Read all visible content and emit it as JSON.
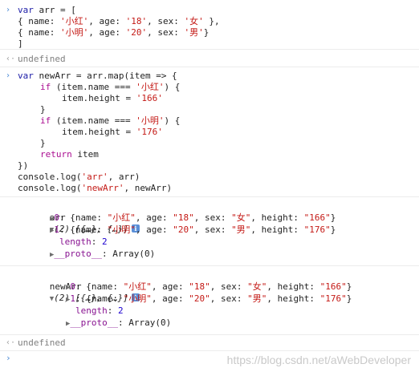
{
  "prompt_glyph": "›",
  "return_glyph": "‹·",
  "expand_glyph": "▶",
  "collapse_glyph": "▼",
  "info_glyph": "i",
  "entry1": {
    "l1_kw": "var",
    "l1_rest": " arr = [",
    "l2_a": "{ name: ",
    "l2_name": "'小红'",
    "l2_b": ", age: ",
    "l2_age": "'18'",
    "l2_c": ", sex: ",
    "l2_sex": "'女'",
    "l2_d": " },",
    "l3_a": "{ name: ",
    "l3_name": "'小明'",
    "l3_b": ", age: ",
    "l3_age": "'20'",
    "l3_c": ", sex: ",
    "l3_sex": "'男'",
    "l3_d": "}",
    "l4": "]"
  },
  "result1": "undefined",
  "entry2": {
    "l1_kw": "var",
    "l1_rest": " newArr = arr.map(item => {",
    "l2_kw": "if",
    "l2_a": " (item.name === ",
    "l2_str": "'小红'",
    "l2_b": ") {",
    "l3_a": "item.height = ",
    "l3_str": "'166'",
    "l4": "}",
    "l5_kw": "if",
    "l5_a": " (item.name === ",
    "l5_str": "'小明'",
    "l5_b": ") {",
    "l6_a": "item.height = ",
    "l6_str": "'176'",
    "l7": "}",
    "l8_kw": "return",
    "l8_rest": " item",
    "l9": "})",
    "l10_a": "console.log(",
    "l10_str": "'arr'",
    "l10_b": ", arr)",
    "l11_a": "console.log(",
    "l11_str": "'newArr'",
    "l11_b": ", newArr)"
  },
  "log_arr": {
    "label": "arr",
    "summary": "(2) [{…}, {…}]",
    "item0_key": "0",
    "item0_a": ": {name: ",
    "item0_name": "\"小红\"",
    "item0_b": ", age: ",
    "item0_age": "\"18\"",
    "item0_c": ", sex: ",
    "item0_sex": "\"女\"",
    "item0_d": ", height: ",
    "item0_height": "\"166\"",
    "item0_e": "}",
    "item1_key": "1",
    "item1_a": ": {name: ",
    "item1_name": "\"小明\"",
    "item1_b": ", age: ",
    "item1_age": "\"20\"",
    "item1_c": ", sex: ",
    "item1_sex": "\"男\"",
    "item1_d": ", height: ",
    "item1_height": "\"176\"",
    "item1_e": "}",
    "length_key": "length",
    "length_val": "2",
    "proto_key": "__proto__",
    "proto_val": "Array(0)"
  },
  "log_newarr": {
    "label": "newArr",
    "summary": "(2) [{…}, {…}]",
    "item0_key": "0",
    "item0_a": ": {name: ",
    "item0_name": "\"小红\"",
    "item0_b": ", age: ",
    "item0_age": "\"18\"",
    "item0_c": ", sex: ",
    "item0_sex": "\"女\"",
    "item0_d": ", height: ",
    "item0_height": "\"166\"",
    "item0_e": "}",
    "item1_key": "1",
    "item1_a": ": {name: ",
    "item1_name": "\"小明\"",
    "item1_b": ", age: ",
    "item1_age": "\"20\"",
    "item1_c": ", sex: ",
    "item1_sex": "\"男\"",
    "item1_d": ", height: ",
    "item1_height": "\"176\"",
    "item1_e": "}",
    "length_key": "length",
    "length_val": "2",
    "proto_key": "__proto__",
    "proto_val": "Array(0)"
  },
  "result2": "undefined",
  "watermark": "https://blog.csdn.net/aWebDeveloper",
  "colors": {
    "prompt": "#4a8ad6",
    "string": "#c41a16",
    "keyword": "#aa0d91",
    "info_badge": "#5a8fd8"
  }
}
